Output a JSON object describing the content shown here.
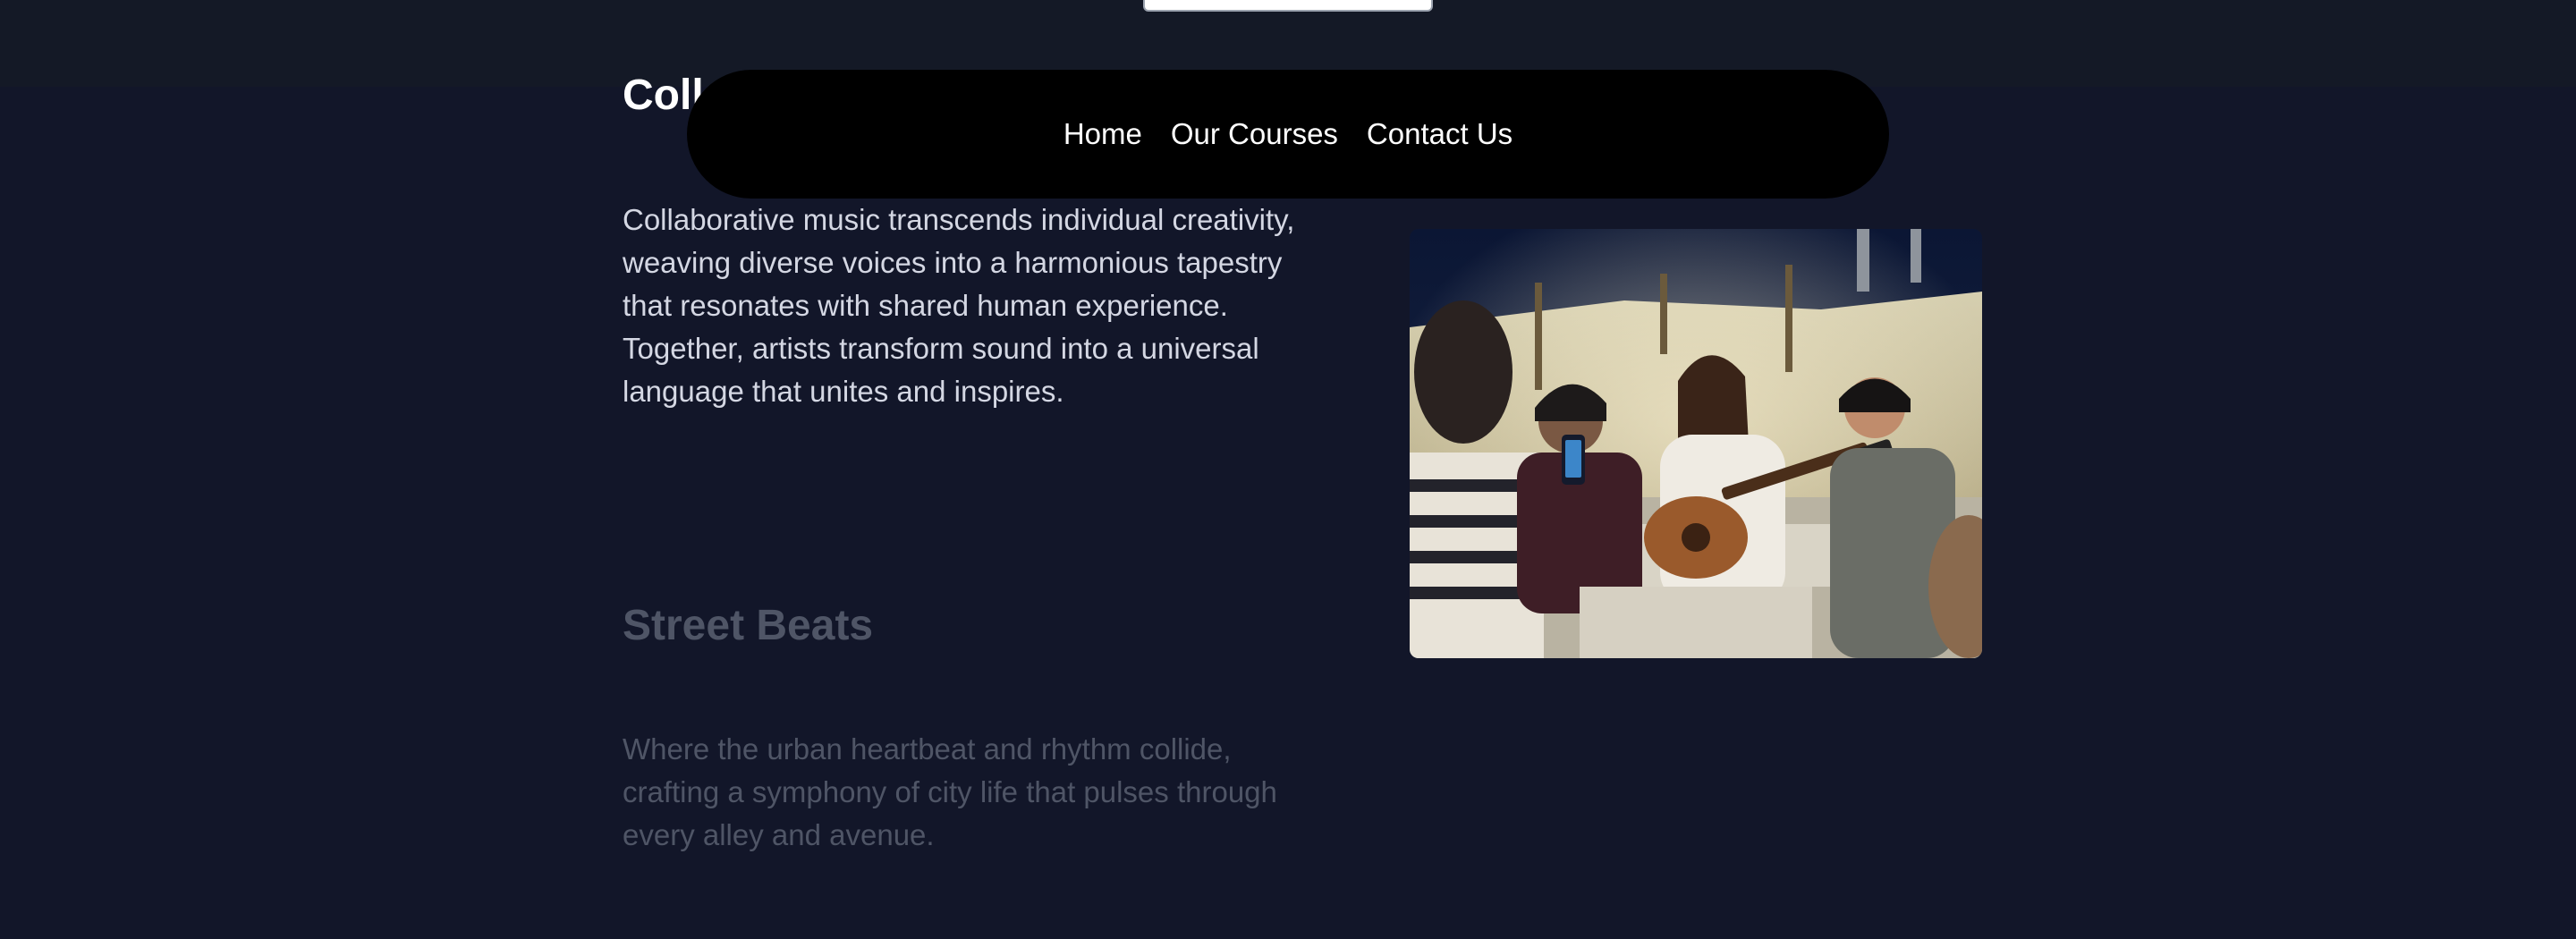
{
  "nav": {
    "links": [
      {
        "label": "Home"
      },
      {
        "label": "Our Courses"
      },
      {
        "label": "Contact Us"
      }
    ]
  },
  "sections": [
    {
      "title": "Collaborative",
      "text": "Collaborative music transcends individual creativity, weaving diverse voices into a harmonious tapestry that resonates with shared human experience. Together, artists transform sound into a universal language that unites and inspires."
    },
    {
      "title": "Street Beats",
      "text": "Where the urban heartbeat and rhythm collide, crafting a symphony of city life that pulses through every alley and avenue."
    }
  ],
  "colors": {
    "background": "#121629",
    "nav_background": "#000000",
    "nav_text": "#ffffff",
    "faded_text": "#4f5566"
  }
}
